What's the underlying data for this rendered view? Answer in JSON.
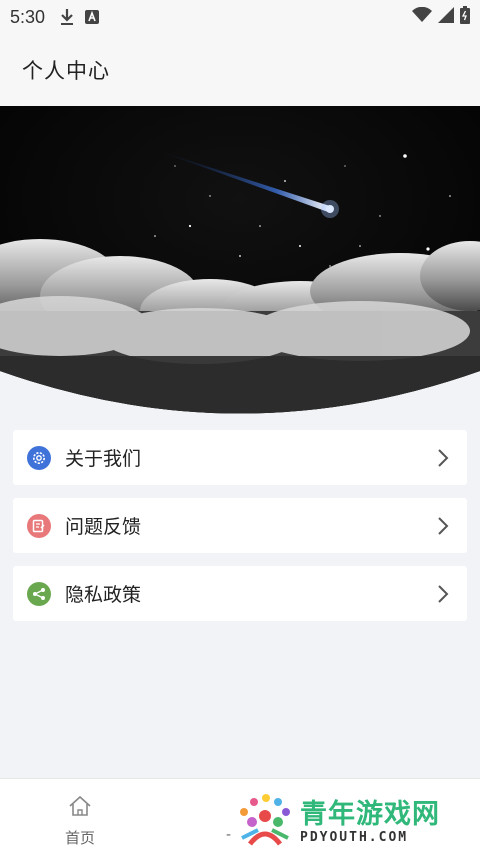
{
  "status_bar": {
    "time": "5:30",
    "icons_left": [
      "download-icon",
      "a-badge-icon"
    ],
    "icons_right": [
      "wifi-icon",
      "signal-icon",
      "battery-icon"
    ]
  },
  "header": {
    "title": "个人中心"
  },
  "hero": {
    "image": "night-sky-shooting-star-clouds"
  },
  "menu": {
    "items": [
      {
        "label": "关于我们",
        "icon": "gear-icon",
        "icon_color": "#3f73d9"
      },
      {
        "label": "问题反馈",
        "icon": "edit-icon",
        "icon_color": "#e8787a"
      },
      {
        "label": "隐私政策",
        "icon": "share-icon",
        "icon_color": "#6aa84f"
      }
    ]
  },
  "bottom_nav": {
    "home_label": "首页",
    "second_label": "-"
  },
  "watermark": {
    "title": "青年游戏网",
    "subtitle": "PDYOUTH.COM"
  },
  "colors": {
    "page_bg": "#f1f3f6",
    "card_bg": "#ffffff",
    "watermark_green": "#2fb87a"
  }
}
